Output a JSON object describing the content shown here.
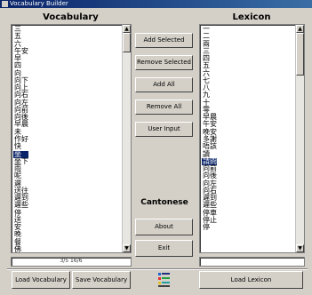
{
  "window": {
    "title": "Vocabulary Builder"
  },
  "vocabulary": {
    "header": "Vocabulary",
    "items": [
      "三",
      "五",
      "六",
      "午安",
      "早",
      "四",
      "向",
      "向下",
      "向上",
      "向右",
      "向左",
      "向前",
      "向後",
      "早晨",
      "未",
      "作好",
      "快",
      "坐",
      "坐下",
      "雨",
      "呢",
      "遲",
      "送往",
      "遲到",
      "遲些",
      "停",
      "送",
      "安",
      "晚",
      "餐",
      "佛",
      "讀",
      "請",
      "問"
    ],
    "selected_index": 17,
    "footer_text": "3/5 16/6"
  },
  "lexicon": {
    "header": "Lexicon",
    "items": [
      "一",
      "二",
      "兩",
      "三",
      "四",
      "五",
      "六",
      "七",
      "八",
      "九",
      "十",
      "零",
      "早晨",
      "午安",
      "晚安",
      "多謝",
      "唔該",
      "讀",
      "請問",
      "向前",
      "向後",
      "向左",
      "向右",
      "遲到",
      "遲些",
      "停車",
      "停止",
      "停"
    ],
    "selected_index": 18
  },
  "buttons": {
    "add_selected": "Add Selected",
    "remove_selected": "Remove Selected",
    "add_all": "Add All",
    "remove_all": "Remove All",
    "user_input": "User Input",
    "about": "About",
    "exit": "Exit",
    "load_vocabulary": "Load Vocabulary",
    "save_vocabulary": "Save Vocabulary",
    "load_lexicon": "Load Lexicon"
  },
  "language_label": "Cantonese",
  "accent": "#0a246a"
}
